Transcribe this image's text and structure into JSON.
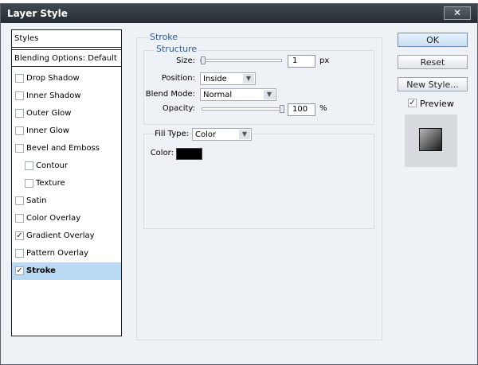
{
  "window": {
    "title": "Layer Style",
    "close_label": "✕"
  },
  "styles_panel": {
    "header": "Styles",
    "blending_options": "Blending Options: Default",
    "items": [
      {
        "label": "Drop Shadow",
        "checked": false,
        "indent": false
      },
      {
        "label": "Inner Shadow",
        "checked": false,
        "indent": false
      },
      {
        "label": "Outer Glow",
        "checked": false,
        "indent": false
      },
      {
        "label": "Inner Glow",
        "checked": false,
        "indent": false
      },
      {
        "label": "Bevel and Emboss",
        "checked": false,
        "indent": false
      },
      {
        "label": "Contour",
        "checked": false,
        "indent": true
      },
      {
        "label": "Texture",
        "checked": false,
        "indent": true
      },
      {
        "label": "Satin",
        "checked": false,
        "indent": false
      },
      {
        "label": "Color Overlay",
        "checked": false,
        "indent": false
      },
      {
        "label": "Gradient Overlay",
        "checked": true,
        "indent": false
      },
      {
        "label": "Pattern Overlay",
        "checked": false,
        "indent": false
      },
      {
        "label": "Stroke",
        "checked": true,
        "indent": false,
        "selected": true
      }
    ]
  },
  "stroke": {
    "legend": "Stroke",
    "structure_legend": "Structure",
    "size_label": "Size:",
    "size_value": "1",
    "size_unit": "px",
    "position_label": "Position:",
    "position_value": "Inside",
    "blend_mode_label": "Blend Mode:",
    "blend_mode_value": "Normal",
    "opacity_label": "Opacity:",
    "opacity_value": "100",
    "opacity_unit": "%",
    "fill_type_label": "Fill Type:",
    "fill_type_value": "Color",
    "color_label": "Color:",
    "stroke_color": "#000000"
  },
  "buttons": {
    "ok": "OK",
    "reset": "Reset",
    "new_style": "New Style...",
    "preview_label": "Preview",
    "preview_checked": true
  },
  "check_glyph": "✓"
}
